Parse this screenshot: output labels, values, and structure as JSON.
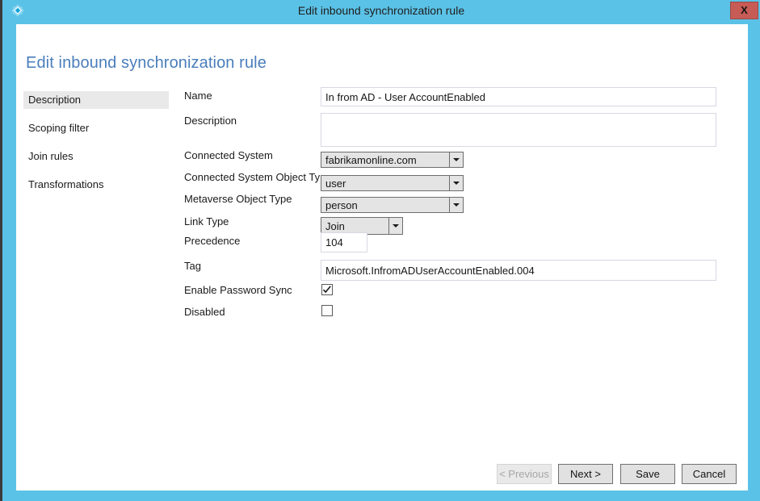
{
  "window": {
    "title": "Edit inbound synchronization rule",
    "app_icon": "sync-diamond-icon",
    "close_label": "X",
    "titlebar_color": "#5bc2e7",
    "close_color": "#c75b55"
  },
  "page": {
    "heading": "Edit inbound synchronization rule",
    "heading_color": "#4a7ebb"
  },
  "sidebar": {
    "items": [
      {
        "label": "Description",
        "selected": true
      },
      {
        "label": "Scoping filter",
        "selected": false
      },
      {
        "label": "Join rules",
        "selected": false
      },
      {
        "label": "Transformations",
        "selected": false
      }
    ]
  },
  "form": {
    "name": {
      "label": "Name",
      "value": "In from AD - User AccountEnabled",
      "placeholder": ""
    },
    "description": {
      "label": "Description",
      "value": "",
      "placeholder": ""
    },
    "connected_system": {
      "label": "Connected System",
      "value": "fabrikamonline.com",
      "options": [
        "fabrikamonline.com"
      ]
    },
    "connected_system_object_type": {
      "label": "Connected System Object Type",
      "value": "user",
      "options": [
        "user"
      ]
    },
    "metaverse_object_type": {
      "label": "Metaverse Object Type",
      "value": "person",
      "options": [
        "person"
      ]
    },
    "link_type": {
      "label": "Link Type",
      "value": "Join",
      "options": [
        "Join"
      ]
    },
    "precedence": {
      "label": "Precedence",
      "value": "104",
      "placeholder": ""
    },
    "tag": {
      "label": "Tag",
      "value": "Microsoft.InfromADUserAccountEnabled.004",
      "placeholder": ""
    },
    "enable_password_sync": {
      "label": "Enable Password Sync",
      "checked": true
    },
    "disabled": {
      "label": "Disabled",
      "checked": false
    }
  },
  "footer": {
    "previous_label": "< Previous",
    "previous_disabled": true,
    "next_label": "Next >",
    "save_label": "Save",
    "cancel_label": "Cancel"
  }
}
